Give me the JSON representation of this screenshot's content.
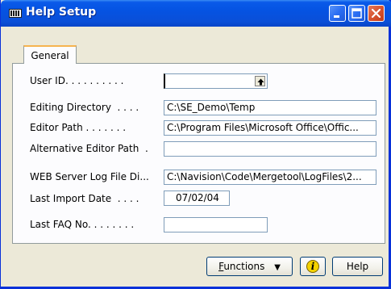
{
  "window": {
    "title": "Help Setup"
  },
  "tabs": [
    {
      "label": "General"
    }
  ],
  "fields": [
    {
      "label": "User ID. . . . . . . . . .",
      "value": ""
    },
    {
      "label": "Editing Directory  . . . .",
      "value": "C:\\SE_Demo\\Temp"
    },
    {
      "label": "Editor Path . . . . . . .",
      "value": "C:\\Program Files\\Microsoft Office\\Offic..."
    },
    {
      "label": "Alternative Editor Path  .",
      "value": ""
    },
    {
      "label": "WEB Server Log File Di...",
      "value": "C:\\Navision\\Code\\Mergetool\\LogFiles\\2..."
    },
    {
      "label": "Last Import Date  . . . .",
      "value": "07/02/04"
    },
    {
      "label": "Last FAQ No. . . . . . . .",
      "value": ""
    }
  ],
  "buttons": {
    "functions_prefix": "F",
    "functions_rest": "unctions",
    "functions_arrow": "▼",
    "info_icon": "i",
    "help": "Help"
  },
  "colors": {
    "title_bar": "#0a4fd8",
    "window_bg": "#ece9d8",
    "tab_highlight": "#f6b44f",
    "close_button": "#d8542f",
    "info_icon_bg": "#f5d300"
  }
}
